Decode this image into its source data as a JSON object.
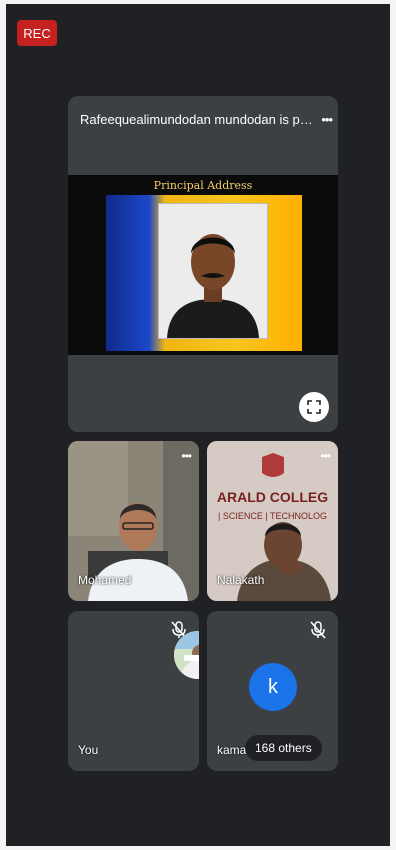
{
  "recording": {
    "badge": "REC"
  },
  "presentation": {
    "title": "Rafeequealimundodan mundodan is p…",
    "slide_caption": "Principal Address"
  },
  "participants": [
    {
      "name": "Mohamed"
    },
    {
      "name": "Nalakath",
      "backdrop_text": "ARALD COLLEG",
      "backdrop_sub": "| SCIENCE | TECHNOLOG"
    },
    {
      "name": "You"
    },
    {
      "name": "kama",
      "avatar_letter": "k"
    }
  ],
  "others_pill": "168 others",
  "colors": {
    "rec": "#c5221f",
    "avatar_blue": "#1a73e8",
    "tile_bg": "#3c4043",
    "app_bg": "#202124"
  }
}
